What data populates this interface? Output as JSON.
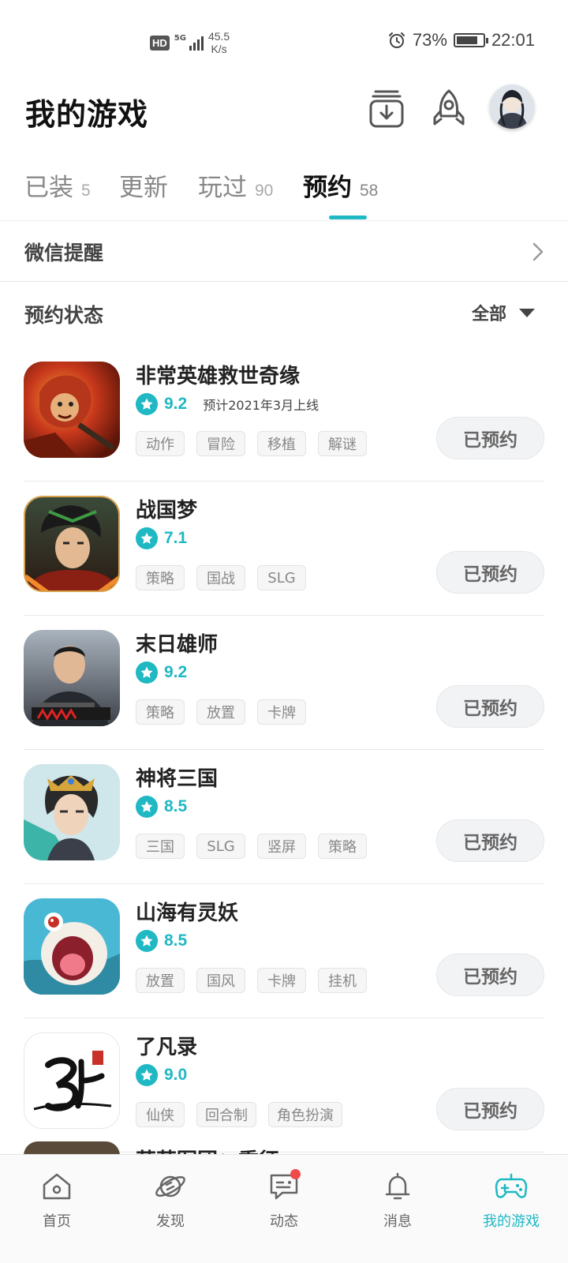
{
  "status_bar": {
    "hd": "HD",
    "network": "5G",
    "speed_value": "45.5",
    "speed_unit": "K/s",
    "battery": "73%",
    "time": "22:01"
  },
  "header": {
    "title": "我的游戏"
  },
  "tabs": [
    {
      "label": "已装",
      "count": "5"
    },
    {
      "label": "更新",
      "count": ""
    },
    {
      "label": "玩过",
      "count": "90"
    },
    {
      "label": "预约",
      "count": "58"
    }
  ],
  "active_tab": "预约",
  "wechat_reminder": {
    "label": "微信提醒"
  },
  "reservation_status": {
    "label": "预约状态",
    "filter_value": "全部"
  },
  "games": [
    {
      "name": "非常英雄救世奇缘",
      "score": "9.2",
      "release": "预计2021年3月上线",
      "tags": [
        "动作",
        "冒险",
        "移植",
        "解谜"
      ],
      "button": "已预约"
    },
    {
      "name": "战国梦",
      "score": "7.1",
      "release": "",
      "tags": [
        "策略",
        "国战",
        "SLG"
      ],
      "button": "已预约"
    },
    {
      "name": "末日雄师",
      "score": "9.2",
      "release": "",
      "tags": [
        "策略",
        "放置",
        "卡牌"
      ],
      "button": "已预约"
    },
    {
      "name": "神将三国",
      "score": "8.5",
      "release": "",
      "tags": [
        "三国",
        "SLG",
        "竖屏",
        "策略"
      ],
      "button": "已预约"
    },
    {
      "name": "山海有灵妖",
      "score": "8.5",
      "release": "",
      "tags": [
        "放置",
        "国风",
        "卡牌",
        "挂机"
      ],
      "button": "已预约"
    },
    {
      "name": "了凡录",
      "score": "9.0",
      "release": "",
      "tags": [
        "仙侠",
        "回合制",
        "角色扮演"
      ],
      "button": "已预约"
    }
  ],
  "partial_game_name": "萌萌军团：重征",
  "bottom_nav": [
    {
      "label": "首页",
      "icon": "home-icon"
    },
    {
      "label": "发现",
      "icon": "planet-icon"
    },
    {
      "label": "动态",
      "icon": "chat-icon"
    },
    {
      "label": "消息",
      "icon": "bell-icon"
    },
    {
      "label": "我的游戏",
      "icon": "gamepad-icon"
    }
  ],
  "colors": {
    "accent": "#1fb8c3",
    "notification_dot": "#f04b4b"
  }
}
